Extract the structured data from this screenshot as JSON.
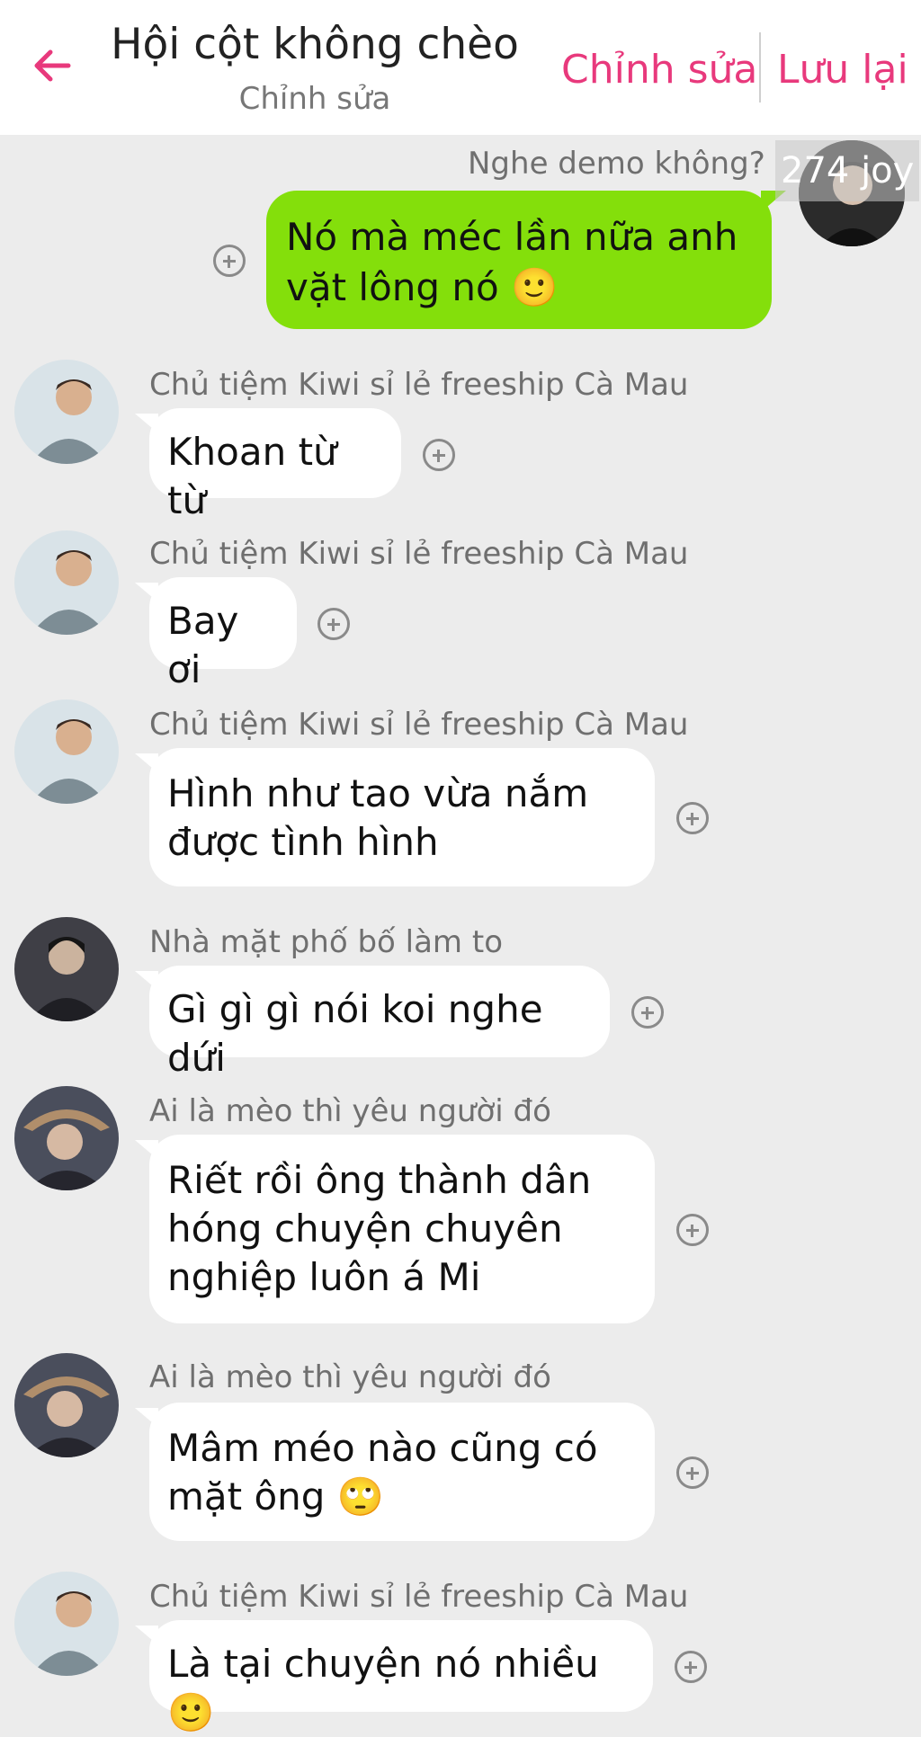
{
  "header": {
    "title": "Hội cột không chèo",
    "subtitle": "Chỉnh sửa",
    "edit_label": "Chỉnh sửa",
    "save_label": "Lưu lại",
    "accent_color": "#e8397c",
    "back_icon": "arrow-left-icon"
  },
  "own_message": {
    "sender": "Nghe demo không?",
    "text": "Nó mà méc lần nữa anh vặt lông nó 🙂",
    "bubble_color": "#84df0b",
    "watermark": "274 joy"
  },
  "messages": [
    {
      "sender": "Chủ tiệm Kiwi sỉ lẻ freeship Cà Mau",
      "text": "Khoan từ từ"
    },
    {
      "sender": "Chủ tiệm Kiwi sỉ lẻ freeship Cà Mau",
      "text": "Bay ơi"
    },
    {
      "sender": "Chủ tiệm Kiwi sỉ lẻ freeship Cà Mau",
      "text": "Hình như tao vừa nắm được tình hình"
    },
    {
      "sender": "Nhà mặt phố bố làm to",
      "text": "Gì gì gì nói koi nghe dứi"
    },
    {
      "sender": "Ai là mèo thì yêu người đó",
      "text": "Riết rồi ông thành dân hóng chuyện chuyên nghiệp luôn á Mi"
    },
    {
      "sender": "Ai là mèo thì yêu người đó",
      "text": "Mâm méo nào cũng có mặt ông 🙄"
    },
    {
      "sender": "Chủ tiệm Kiwi sỉ lẻ freeship Cà Mau",
      "text": "Là tại chuyện nó nhiều 🙂"
    }
  ]
}
